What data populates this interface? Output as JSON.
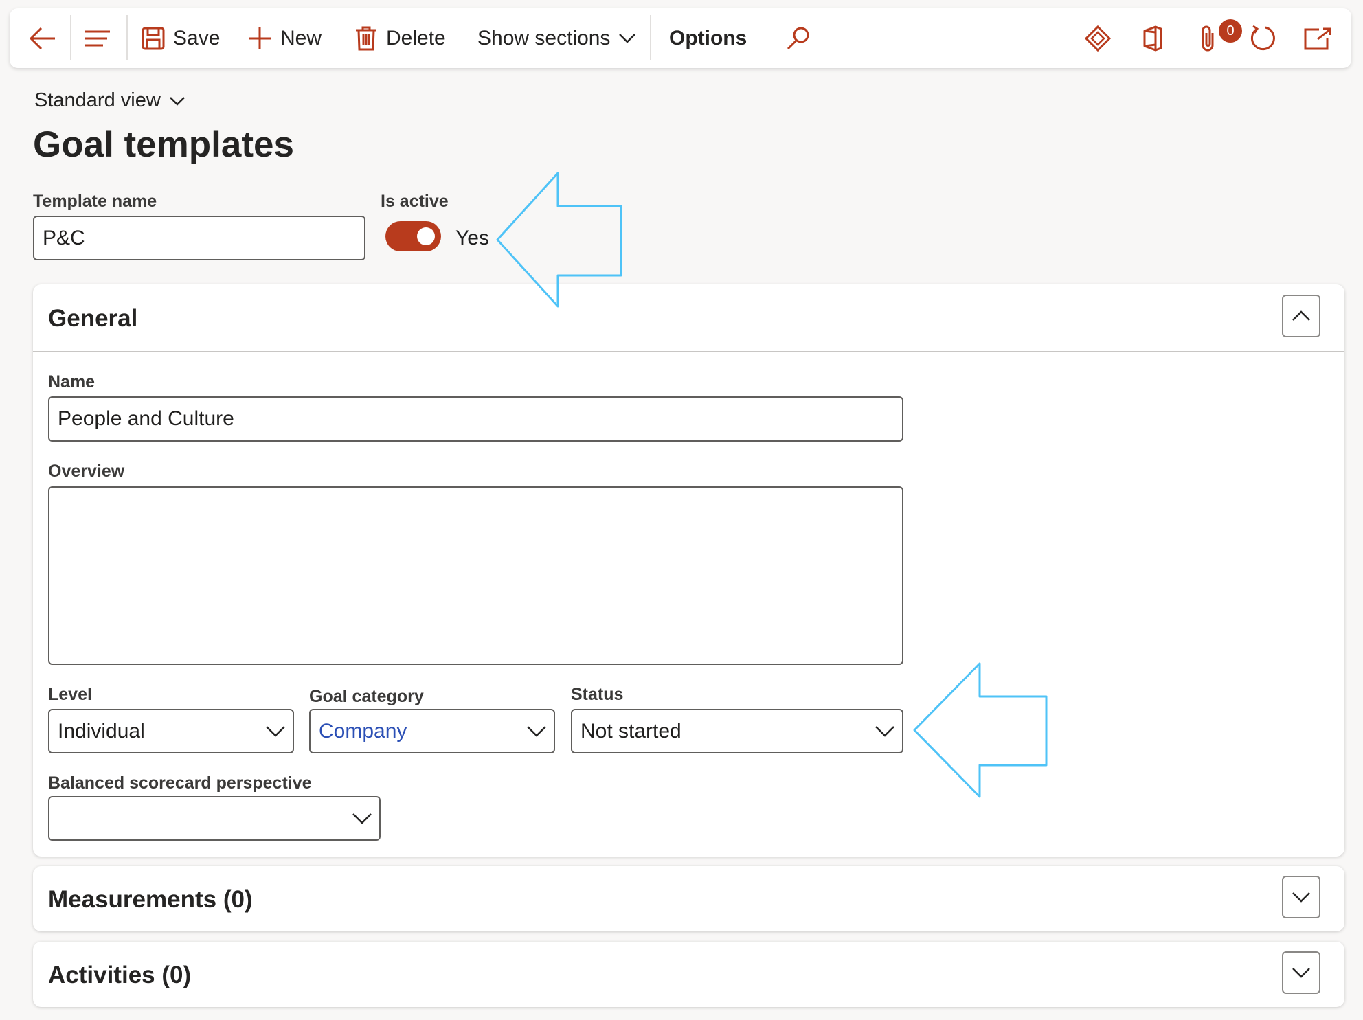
{
  "toolbar": {
    "save": "Save",
    "new": "New",
    "delete": "Delete",
    "show_sections": "Show sections",
    "options": "Options",
    "attachments_count": "0"
  },
  "header": {
    "view": "Standard view",
    "title": "Goal templates"
  },
  "template": {
    "name_label": "Template name",
    "name_value": "P&C",
    "active_label": "Is active",
    "active_value": "Yes"
  },
  "general": {
    "title": "General",
    "name_label": "Name",
    "name_value": "People and Culture",
    "overview_label": "Overview",
    "overview_value": "",
    "level_label": "Level",
    "level_value": "Individual",
    "category_label": "Goal category",
    "category_value": "Company",
    "status_label": "Status",
    "status_value": "Not started",
    "bsc_label": "Balanced scorecard perspective",
    "bsc_value": ""
  },
  "measurements": {
    "title": "Measurements (0)"
  },
  "activities": {
    "title": "Activities (0)"
  },
  "colors": {
    "accent": "#b83b1d",
    "link": "#2b4fb5",
    "annotation_arrow": "#4fc3f7"
  }
}
